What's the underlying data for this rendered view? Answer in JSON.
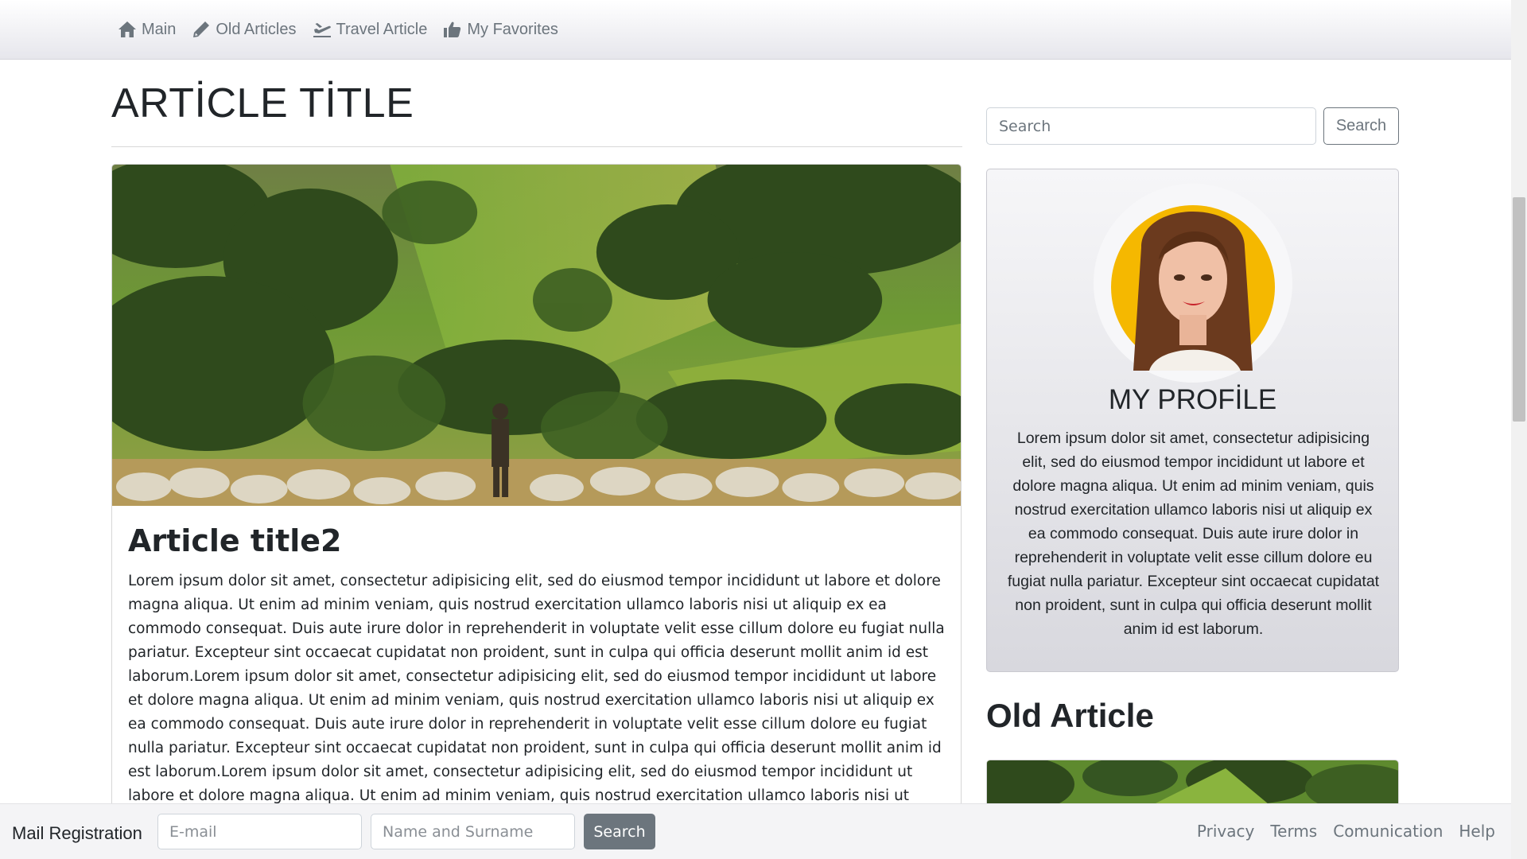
{
  "nav": {
    "items": [
      {
        "label": "Main",
        "icon": "home-icon"
      },
      {
        "label": "Old Articles",
        "icon": "pencil-icon"
      },
      {
        "label": "Travel Article",
        "icon": "plane-icon"
      },
      {
        "label": "My Favorites",
        "icon": "thumbs-up-icon"
      }
    ]
  },
  "main": {
    "page_title": "ARTİCLE TİTLE",
    "article": {
      "image": "pasture-with-shepherd-and-sheep-image",
      "heading": "Article title2",
      "text": "Lorem ipsum dolor sit amet, consectetur adipisicing elit, sed do eiusmod tempor incididunt ut labore et dolore magna aliqua. Ut enim ad minim veniam, quis nostrud exercitation ullamco laboris nisi ut aliquip ex ea commodo consequat. Duis aute irure dolor in reprehenderit in voluptate velit esse cillum dolore eu fugiat nulla pariatur. Excepteur sint occaecat cupidatat non proident, sunt in culpa qui officia deserunt mollit anim id est laborum.Lorem ipsum dolor sit amet, consectetur adipisicing elit, sed do eiusmod tempor incididunt ut labore et dolore magna aliqua. Ut enim ad minim veniam, quis nostrud exercitation ullamco laboris nisi ut aliquip ex ea commodo consequat. Duis aute irure dolor in reprehenderit in voluptate velit esse cillum dolore eu fugiat nulla pariatur. Excepteur sint occaecat cupidatat non proident, sunt in culpa qui officia deserunt mollit anim id est laborum.Lorem ipsum dolor sit amet, consectetur adipisicing elit, sed do eiusmod tempor incididunt ut labore et dolore magna aliqua. Ut enim ad minim veniam, quis nostrud exercitation ullamco laboris nisi ut aliquip ex ea commodo"
    }
  },
  "sidebar": {
    "search": {
      "placeholder": "Search",
      "button_label": "Search"
    },
    "profile": {
      "avatar": "woman-portrait-avatar",
      "title": "MY PROFİLE",
      "text": "Lorem ipsum dolor sit amet, consectetur adipisicing elit, sed do eiusmod tempor incididunt ut labore et dolore magna aliqua. Ut enim ad minim veniam, quis nostrud exercitation ullamco laboris nisi ut aliquip ex ea commodo consequat. Duis aute irure dolor in reprehenderit in voluptate velit esse cillum dolore eu fugiat nulla pariatur. Excepteur sint occaecat cupidatat non proident, sunt in culpa qui officia deserunt mollit anim id est laborum."
    },
    "old_article": {
      "heading": "Old Article"
    }
  },
  "footer": {
    "title": "Mail Registration",
    "email_placeholder": "E-mail",
    "name_placeholder": "Name and Surname",
    "button_label": "Search",
    "links": [
      "Privacy",
      "Terms",
      "Comunication",
      "Help"
    ]
  },
  "colors": {
    "muted": "#6c757d",
    "text": "#212529",
    "avatar_bg": "#f5b800"
  }
}
